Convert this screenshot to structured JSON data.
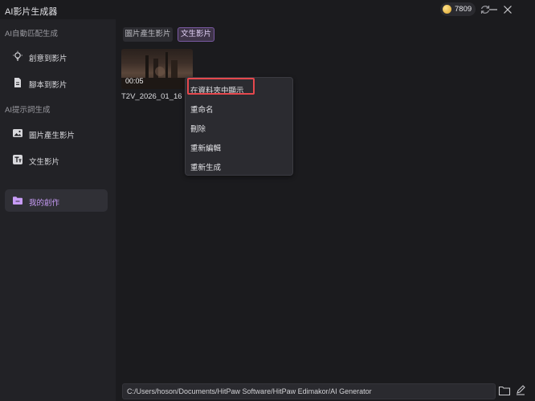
{
  "app": {
    "title": "AI影片生成器",
    "credits": "7809"
  },
  "sidebar": {
    "section1": "AI自動匹配生成",
    "section2": "AI提示詞生成",
    "items": [
      {
        "label": "創意到影片",
        "icon": "lightbulb-icon"
      },
      {
        "label": "腳本到影片",
        "icon": "document-icon"
      },
      {
        "label": "圖片產生影片",
        "icon": "image-icon"
      },
      {
        "label": "文生影片",
        "icon": "text-icon"
      },
      {
        "label": "我的創作",
        "icon": "folder-icon"
      }
    ]
  },
  "main": {
    "tabs": [
      {
        "label": "圖片產生影片"
      },
      {
        "label": "文生影片"
      }
    ],
    "video": {
      "duration": "00:05",
      "name": "T2V_2026_01_16"
    }
  },
  "context_menu": {
    "items": [
      "在資料夾中顯示",
      "重命名",
      "刪除",
      "重新編輯",
      "重新生成"
    ]
  },
  "footer": {
    "path": "C:/Users/hoson/Documents/HitPaw Software/HitPaw Edimakor/AI Generator"
  },
  "colors": {
    "accent": "#c89cf7",
    "highlight": "#e5484d",
    "coin": "#e0a93a"
  }
}
